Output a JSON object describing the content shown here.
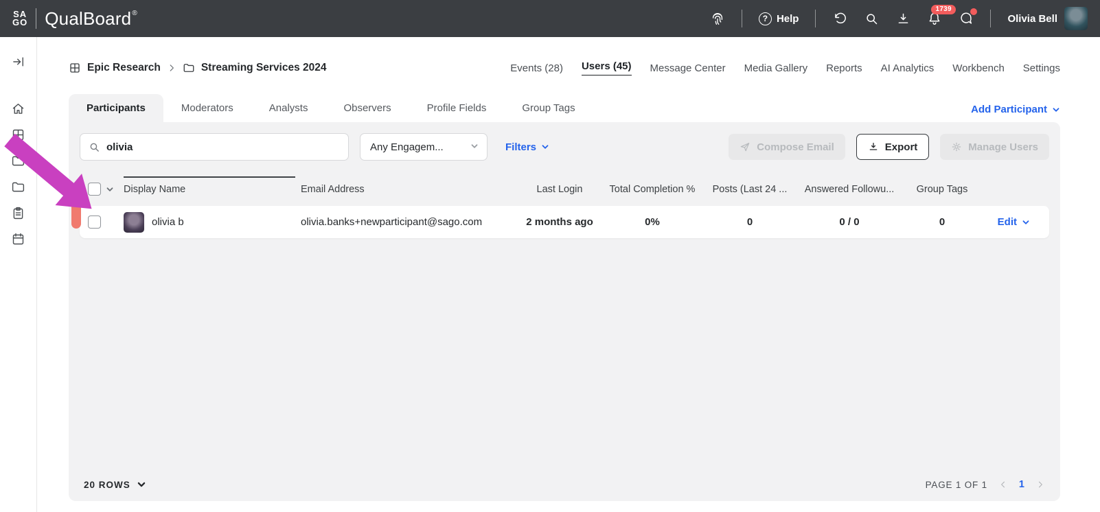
{
  "topbar": {
    "logo_line1": "SA",
    "logo_line2": "GO",
    "brand": "QualBoard",
    "brand_mark": "®",
    "help_label": "Help",
    "notification_count": "1739",
    "user_name": "Olivia Bell"
  },
  "icons": {
    "help_glyph": "?"
  },
  "breadcrumb": {
    "project": "Epic Research",
    "folder": "Streaming Services 2024"
  },
  "nav": {
    "items": [
      {
        "label": "Events (28)"
      },
      {
        "label": "Users (45)"
      },
      {
        "label": "Message Center"
      },
      {
        "label": "Media Gallery"
      },
      {
        "label": "Reports"
      },
      {
        "label": "AI Analytics"
      },
      {
        "label": "Workbench"
      },
      {
        "label": "Settings"
      }
    ]
  },
  "tabs": {
    "items": [
      "Participants",
      "Moderators",
      "Analysts",
      "Observers",
      "Profile Fields",
      "Group Tags"
    ],
    "add_participant_label": "Add Participant"
  },
  "toolbar": {
    "search_value": "olivia",
    "engagement_value": "Any Engagem...",
    "filters_label": "Filters",
    "compose_email_label": "Compose Email",
    "export_label": "Export",
    "manage_users_label": "Manage Users"
  },
  "table": {
    "headers": {
      "display_name": "Display Name",
      "email": "Email Address",
      "last_login": "Last Login",
      "completion": "Total Completion %",
      "posts": "Posts (Last 24 ...",
      "answered": "Answered Followu...",
      "group_tags": "Group Tags"
    },
    "rows": [
      {
        "display_name": "olivia b",
        "email": "olivia.banks+newparticipant@sago.com",
        "last_login": "2 months ago",
        "completion": "0%",
        "posts": "0",
        "answered": "0 / 0",
        "group_tags": "0",
        "edit_label": "Edit"
      }
    ]
  },
  "footer": {
    "rows_label": "20 ROWS",
    "page_label": "PAGE 1 OF 1",
    "current_page": "1"
  },
  "colors": {
    "accent_blue": "#2463eb",
    "badge_red": "#f25c5c",
    "topbar_bg": "#3b3e42",
    "annotation_magenta": "#c940c0",
    "annotation_salmon": "#f07a6e"
  }
}
